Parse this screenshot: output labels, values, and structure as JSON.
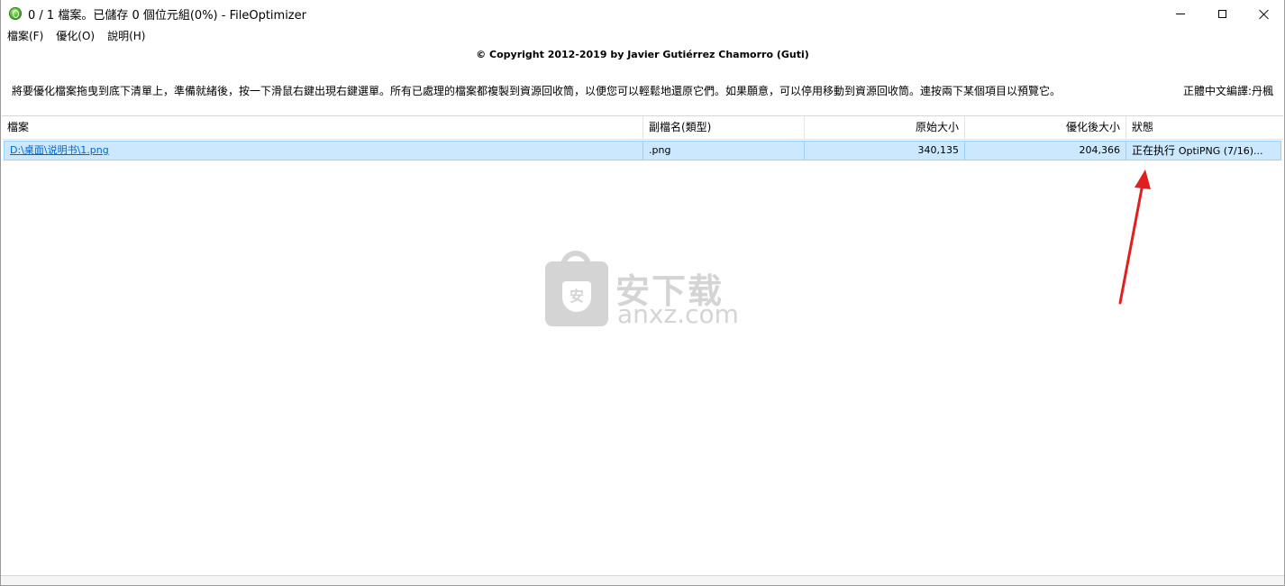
{
  "window": {
    "title": "0 / 1 檔案。已儲存 0 個位元組(0%) - FileOptimizer"
  },
  "menu": {
    "items": [
      "檔案(F)",
      "優化(O)",
      "說明(H)"
    ]
  },
  "header": {
    "copyright": "© Copyright 2012-2019 by Javier Gutiérrez Chamorro (Guti)",
    "instructions": "將要優化檔案拖曳到底下清單上，準備就緒後，按一下滑鼠右鍵出現右鍵選單。所有已處理的檔案都複製到資源回收筒，以便您可以輕鬆地還原它們。如果願意，可以停用移動到資源回收筒。連按兩下某個項目以預覽它。",
    "translator": "正體中文編譯:丹楓"
  },
  "list": {
    "columns": [
      "檔案",
      "副檔名(類型)",
      "原始大小",
      "優化後大小",
      "狀態"
    ],
    "rows": [
      {
        "file": "D:\\桌面\\说明书\\1.png",
        "ext": ".png",
        "original": "340,135",
        "optimized": "204,366",
        "status_main": "正在执行",
        "status_sub": "OptiPNG (7/16)..."
      }
    ]
  },
  "watermark": {
    "cn": "安下载",
    "en": "anxz.com",
    "badge": "安"
  },
  "colors": {
    "selection": "#cce8ff",
    "selection_border": "#99d1ff",
    "link": "#0066cc",
    "annotation_arrow": "#e02020"
  }
}
